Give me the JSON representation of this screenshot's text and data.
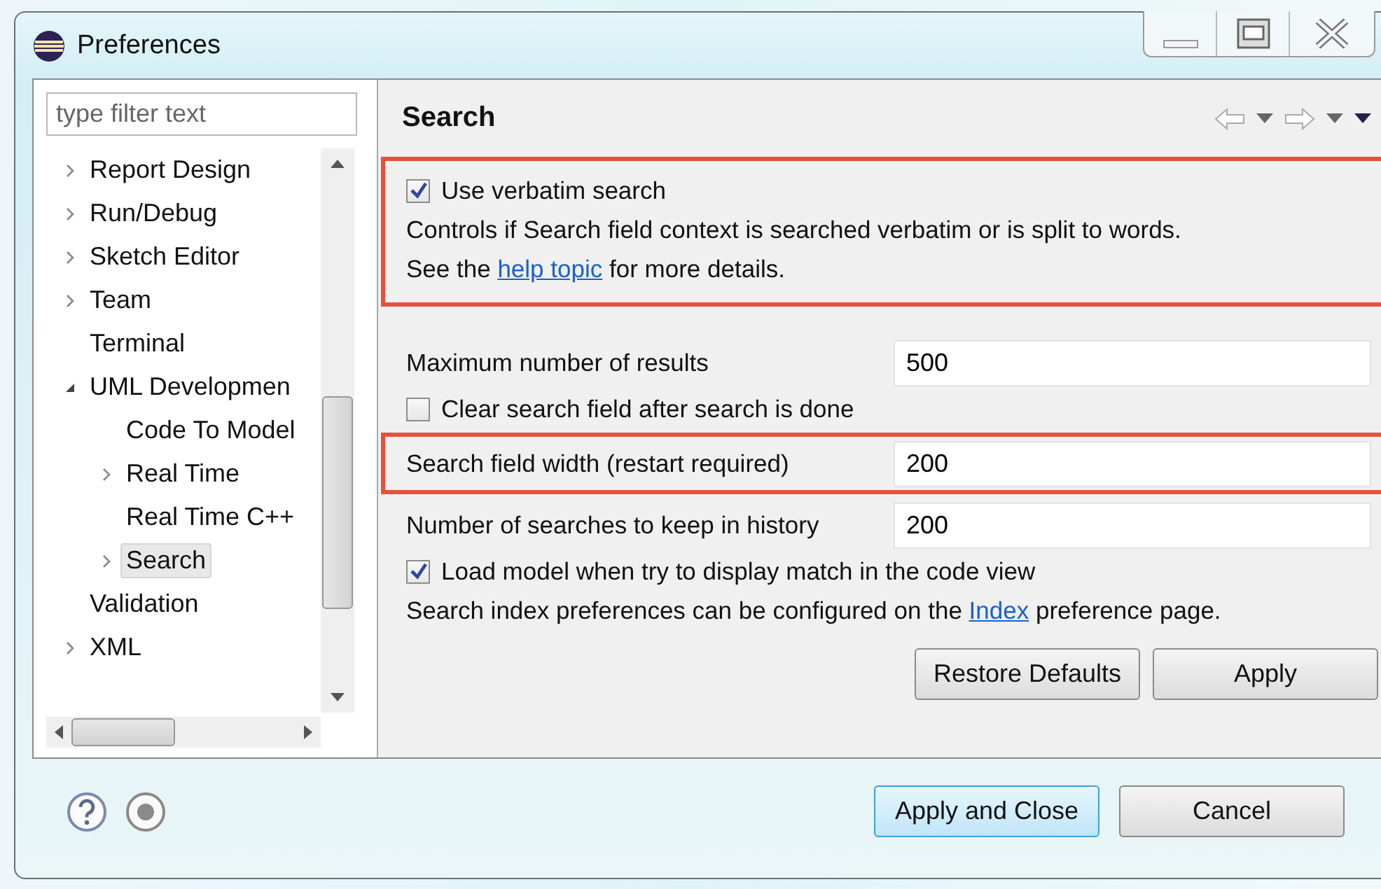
{
  "window": {
    "title": "Preferences"
  },
  "filter": {
    "placeholder": "type filter text"
  },
  "tree": [
    {
      "label": "Report Design",
      "kind": "collapsed",
      "selected": false
    },
    {
      "label": "Run/Debug",
      "kind": "collapsed",
      "selected": false
    },
    {
      "label": "Sketch Editor",
      "kind": "collapsed",
      "selected": false
    },
    {
      "label": "Team",
      "kind": "collapsed",
      "selected": false
    },
    {
      "label": "Terminal",
      "kind": "leaf",
      "selected": false
    },
    {
      "label": "UML Developmen",
      "kind": "expanded",
      "selected": false,
      "children": [
        {
          "label": "Code To Model",
          "kind": "leaf",
          "selected": false
        },
        {
          "label": "Real Time",
          "kind": "collapsed",
          "selected": false
        },
        {
          "label": "Real Time C++",
          "kind": "leaf",
          "selected": false
        },
        {
          "label": "Search",
          "kind": "collapsed",
          "selected": true
        }
      ]
    },
    {
      "label": "Validation",
      "kind": "leaf",
      "selected": false
    },
    {
      "label": "XML",
      "kind": "collapsed",
      "selected": false
    }
  ],
  "page": {
    "title": "Search",
    "sections": [
      {
        "highlighted": true,
        "rows": [
          {
            "kind": "checkbox",
            "label": "Use verbatim search",
            "checked": true
          },
          {
            "kind": "note",
            "text": "Controls if Search field context is searched verbatim or is split to words."
          },
          {
            "kind": "link_note",
            "before": "See the",
            "link": "help topic",
            "after": "for more details."
          }
        ]
      },
      {
        "highlighted": false,
        "rows": [
          {
            "kind": "field",
            "label": "Maximum number of results",
            "value": "500"
          },
          {
            "kind": "checkbox",
            "label": "Clear search field after search is done",
            "checked": false
          }
        ]
      },
      {
        "highlighted": true,
        "rows": [
          {
            "kind": "field",
            "label": "Search field width (restart required)",
            "value": "200"
          }
        ]
      },
      {
        "highlighted": false,
        "rows": [
          {
            "kind": "field",
            "label": "Number of searches to keep in history",
            "value": "200"
          },
          {
            "kind": "checkbox",
            "label": "Load model when try to display match in the code view",
            "checked": true
          },
          {
            "kind": "link_note",
            "before": "Search index preferences can be configured on the",
            "link": "Index",
            "after": "preference page."
          }
        ]
      }
    ],
    "buttons": [
      {
        "label": "Restore Defaults",
        "default": false
      },
      {
        "label": "Apply",
        "default": false
      }
    ]
  },
  "footer_buttons": [
    {
      "label": "Apply and Close",
      "default": true
    },
    {
      "label": "Cancel",
      "default": false
    }
  ]
}
